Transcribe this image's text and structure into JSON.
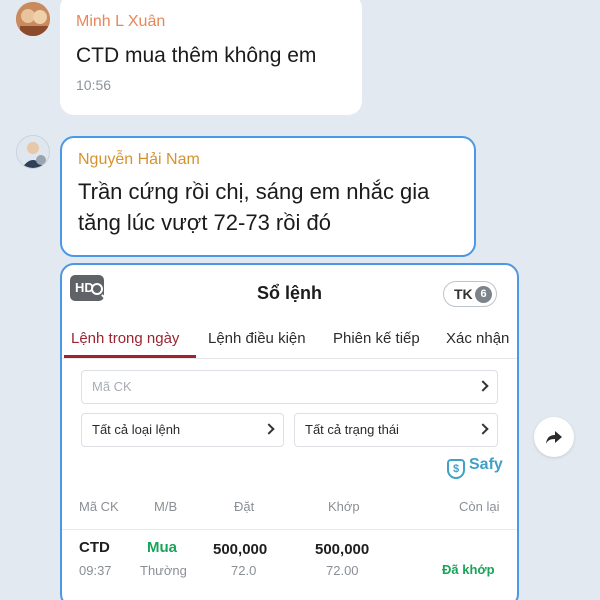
{
  "messages": [
    {
      "sender": "Minh L Xuân",
      "text": "CTD mua thêm không em",
      "time": "10:56",
      "avatar_icon": "user-photo-avatar"
    },
    {
      "sender": "Nguyễn Hải Nam",
      "text_line1": "Trần cứng rồi chị, sáng em nhắc gia",
      "text_line2": "tăng lúc vượt 72-73 rồi đó",
      "avatar_icon": "user-photo-avatar"
    }
  ],
  "screenshot": {
    "hd_label": "HD",
    "title": "Sổ lệnh",
    "account_label": "TK",
    "account_number": "6",
    "tabs": [
      {
        "label": "Lệnh trong ngày",
        "active": true
      },
      {
        "label": "Lệnh điều kiện",
        "active": false
      },
      {
        "label": "Phiên kế tiếp",
        "active": false
      },
      {
        "label": "Xác nhận",
        "active": false
      }
    ],
    "filters": {
      "symbol_placeholder": "Mã CK",
      "order_type": "Tất cả loại lệnh",
      "status": "Tất cả trạng thái"
    },
    "brand": "Safy",
    "columns": [
      "Mã CK",
      "M/B",
      "Đặt",
      "Khớp",
      "Còn lại"
    ],
    "rows": [
      {
        "symbol": "CTD",
        "time": "09:37",
        "side": "Mua",
        "order_kind": "Thường",
        "order_qty": "500,000",
        "order_price": "72.0",
        "match_qty": "500,000",
        "match_price": "72.00",
        "status": "Đã khớp"
      }
    ]
  },
  "colors": {
    "accent_blue": "#4b98e6",
    "active_tab": "#9a2430",
    "buy_green": "#1aa35a",
    "sender1": "#e8865a",
    "sender2": "#d6932d"
  },
  "icons": [
    "share-forward-icon",
    "chevron-right-icon",
    "shield-icon",
    "magnifier-icon"
  ]
}
